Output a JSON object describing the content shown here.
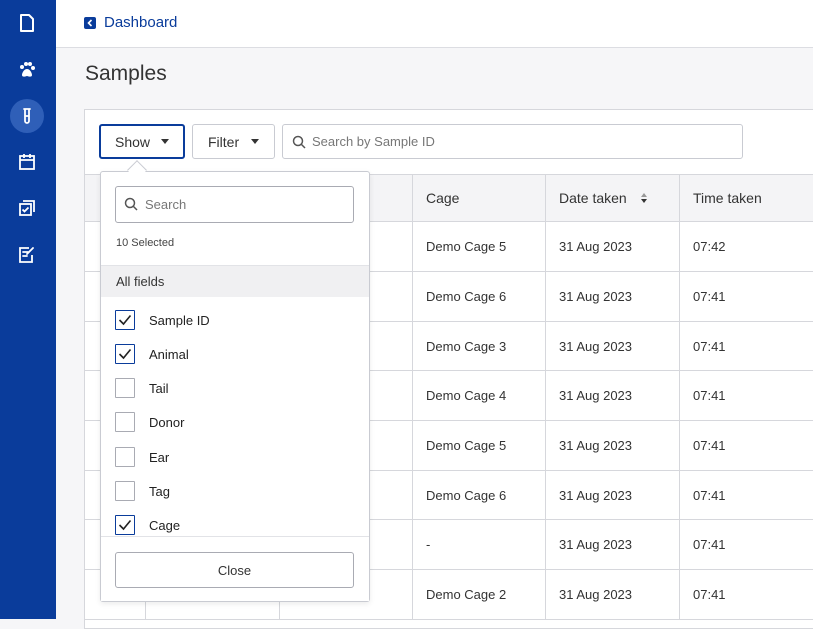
{
  "sidebar": {
    "icons": [
      "document-icon",
      "paw-icon",
      "test-tube-icon",
      "calendar-icon",
      "tasks-icon",
      "checklist-edit-icon"
    ],
    "active": "test-tube-icon"
  },
  "topbar": {
    "back_label": "Dashboard"
  },
  "page": {
    "title": "Samples"
  },
  "toolbar": {
    "show_label": "Show",
    "filter_label": "Filter",
    "search_placeholder": "Search by Sample ID"
  },
  "table": {
    "headers": {
      "cage": "Cage",
      "date": "Date taken",
      "time": "Time taken"
    },
    "rows": [
      {
        "cage": "Demo Cage 5",
        "date": "31 Aug 2023",
        "time": "07:42"
      },
      {
        "cage": "Demo Cage 6",
        "date": "31 Aug 2023",
        "time": "07:41"
      },
      {
        "cage": "Demo Cage 3",
        "date": "31 Aug 2023",
        "time": "07:41"
      },
      {
        "cage": "Demo Cage 4",
        "date": "31 Aug 2023",
        "time": "07:41"
      },
      {
        "cage": "Demo Cage 5",
        "date": "31 Aug 2023",
        "time": "07:41"
      },
      {
        "cage": "Demo Cage 6",
        "date": "31 Aug 2023",
        "time": "07:41"
      },
      {
        "cage": "-",
        "date": "31 Aug 2023",
        "time": "07:41"
      },
      {
        "cage": "Demo Cage 2",
        "date": "31 Aug 2023",
        "time": "07:41"
      }
    ]
  },
  "dropdown": {
    "search_placeholder": "Search",
    "selected_count": "10 Selected",
    "group_label": "All fields",
    "options": [
      {
        "label": "Sample ID",
        "checked": true
      },
      {
        "label": "Animal",
        "checked": true
      },
      {
        "label": "Tail",
        "checked": false
      },
      {
        "label": "Donor",
        "checked": false
      },
      {
        "label": "Ear",
        "checked": false
      },
      {
        "label": "Tag",
        "checked": false
      },
      {
        "label": "Cage",
        "checked": true
      }
    ],
    "close_label": "Close"
  },
  "colors": {
    "brand": "#0a3c9b",
    "sidebar_active": "#2f5fb8"
  }
}
